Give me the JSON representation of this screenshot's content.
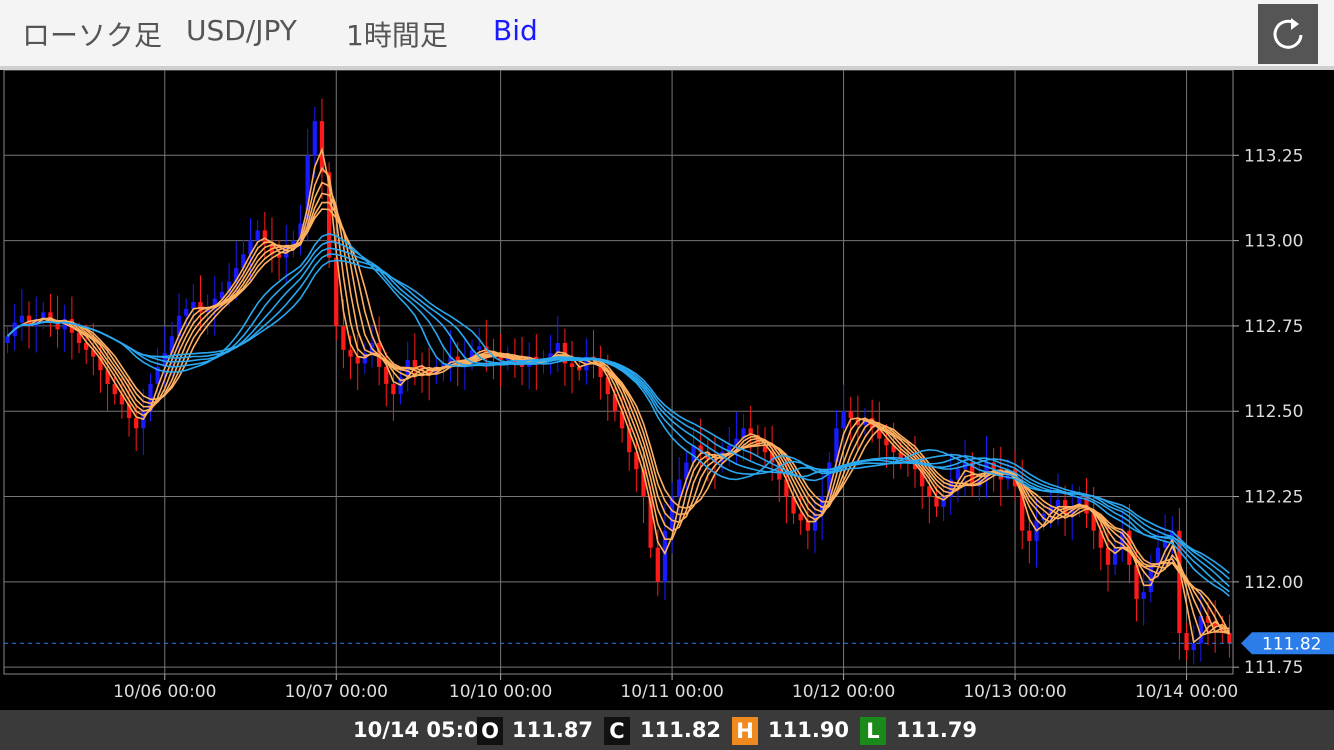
{
  "header": {
    "chart_type": "ローソク足",
    "pair": "USD/JPY",
    "timeframe": "1時間足",
    "price_type": "Bid",
    "refresh_icon": "refresh-icon"
  },
  "ohlc": {
    "time": "10/14 05:00",
    "open_label": "O",
    "open": "111.87",
    "close_label": "C",
    "close": "111.82",
    "high_label": "H",
    "high": "111.90",
    "low_label": "L",
    "low": "111.79"
  },
  "colors": {
    "up": "#1a1aff",
    "down": "#ff1a1a",
    "ma_short": "#ffb060",
    "ma_long": "#29a8f0",
    "current_price": "#2b7de9",
    "high_badge": "#f08a1e",
    "low_badge": "#1a8a1a",
    "bid": "#1a1aff"
  },
  "chart_data": {
    "type": "candlestick",
    "y_ticks": [
      "113.25",
      "113.00",
      "112.75",
      "112.50",
      "112.25",
      "112.00",
      "111.75"
    ],
    "ylim": [
      111.73,
      113.5
    ],
    "current_price": "111.82",
    "x_labels": [
      "10/06 00:00",
      "10/07 00:00",
      "10/10 00:00",
      "10/11 00:00",
      "10/12 00:00",
      "10/13 00:00",
      "10/14 00:00"
    ],
    "x_label_index": [
      22,
      46,
      69,
      93,
      117,
      141,
      165
    ],
    "grid": true,
    "close_series": [
      112.72,
      112.76,
      112.78,
      112.75,
      112.77,
      112.79,
      112.76,
      112.74,
      112.77,
      112.73,
      112.7,
      112.68,
      112.66,
      112.62,
      112.58,
      112.55,
      112.52,
      112.48,
      112.45,
      112.5,
      112.58,
      112.63,
      112.67,
      112.72,
      112.78,
      112.8,
      112.82,
      112.79,
      112.8,
      112.83,
      112.85,
      112.88,
      112.92,
      112.96,
      113.0,
      113.03,
      112.99,
      112.96,
      112.95,
      112.98,
      113.0,
      113.05,
      113.25,
      113.35,
      113.2,
      112.95,
      112.75,
      112.68,
      112.66,
      112.64,
      112.67,
      112.7,
      112.63,
      112.58,
      112.55,
      112.6,
      112.65,
      112.63,
      112.62,
      112.61,
      112.63,
      112.64,
      112.66,
      112.64,
      112.65,
      112.68,
      112.69,
      112.67,
      112.66,
      112.65,
      112.66,
      112.64,
      112.63,
      112.66,
      112.64,
      112.65,
      112.67,
      112.7,
      112.64,
      112.63,
      112.62,
      112.66,
      112.65,
      112.6,
      112.55,
      112.5,
      112.45,
      112.38,
      112.33,
      112.25,
      112.1,
      112.0,
      112.15,
      112.25,
      112.3,
      112.35,
      112.4,
      112.38,
      112.36,
      112.35,
      112.38,
      112.4,
      112.42,
      112.45,
      112.43,
      112.4,
      112.38,
      112.35,
      112.3,
      112.25,
      112.2,
      112.18,
      112.15,
      112.2,
      112.25,
      112.35,
      112.45,
      112.5,
      112.48,
      112.46,
      112.48,
      112.45,
      112.42,
      112.4,
      112.38,
      112.36,
      112.35,
      112.33,
      112.28,
      112.25,
      112.22,
      112.25,
      112.3,
      112.33,
      112.35,
      112.28,
      112.3,
      112.35,
      112.33,
      112.3,
      112.33,
      112.28,
      112.15,
      112.12,
      112.18,
      112.2,
      112.22,
      112.24,
      112.2,
      112.22,
      112.25,
      112.2,
      112.15,
      112.1,
      112.05,
      112.1,
      112.15,
      112.05,
      111.95,
      111.97,
      112.05,
      112.1,
      112.12,
      112.15,
      111.85,
      111.8,
      111.82,
      111.9,
      111.88,
      111.87,
      111.85,
      111.82
    ]
  }
}
